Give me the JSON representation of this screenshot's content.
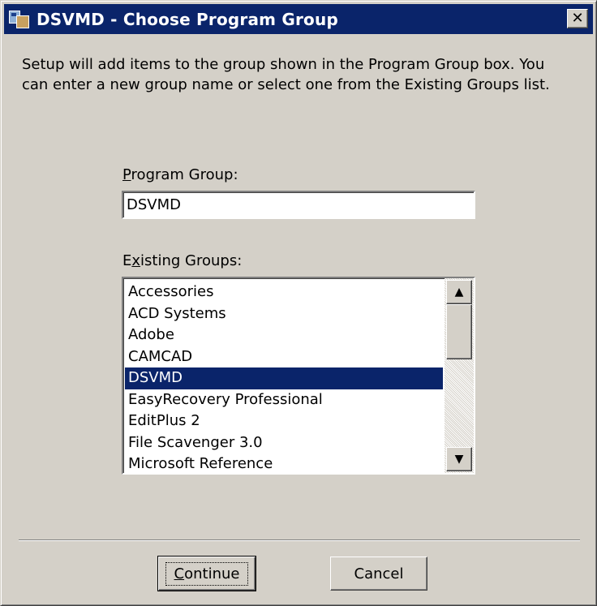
{
  "window": {
    "title": "DSVMD - Choose Program Group",
    "close_symbol": "✕"
  },
  "description": "Setup will add items to the group shown in the Program Group box. You can enter a new group name or select one from the Existing Groups list.",
  "program_group": {
    "label_mnemonic": "P",
    "label_rest": "rogram Group:",
    "value": "DSVMD"
  },
  "existing_groups": {
    "label_before": "E",
    "label_mnemonic": "x",
    "label_after": "isting Groups:",
    "items": [
      {
        "label": "Accessories",
        "selected": false
      },
      {
        "label": "ACD Systems",
        "selected": false
      },
      {
        "label": "Adobe",
        "selected": false
      },
      {
        "label": "CAMCAD",
        "selected": false
      },
      {
        "label": "DSVMD",
        "selected": true
      },
      {
        "label": "EasyRecovery Professional",
        "selected": false
      },
      {
        "label": "EditPlus 2",
        "selected": false
      },
      {
        "label": "File Scavenger 3.0",
        "selected": false
      },
      {
        "label": "Microsoft Reference",
        "selected": false
      }
    ],
    "scroll_up_symbol": "▲",
    "scroll_down_symbol": "▼"
  },
  "buttons": {
    "continue_mnemonic": "C",
    "continue_rest": "ontinue",
    "cancel": "Cancel"
  },
  "colors": {
    "title_bar": "#0a246a",
    "face": "#d4d0c8",
    "selection": "#0a246a"
  }
}
